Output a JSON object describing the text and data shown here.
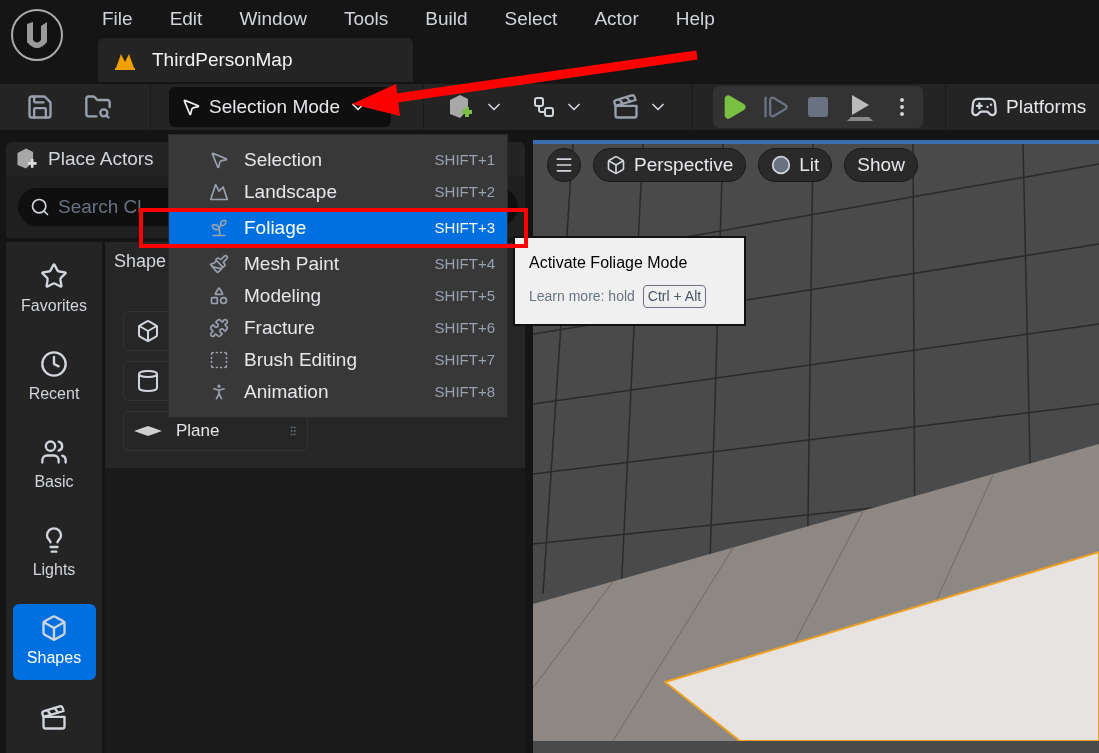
{
  "menu_bar": [
    "File",
    "Edit",
    "Window",
    "Tools",
    "Build",
    "Select",
    "Actor",
    "Help"
  ],
  "document_tab": {
    "title": "ThirdPersonMap",
    "selected": true
  },
  "toolbar": {
    "mode_button": "Selection Mode",
    "platforms_button": "Platforms"
  },
  "place_actors": {
    "title": "Place Actors",
    "search": {
      "placeholder": "Search Cl"
    },
    "categories": [
      {
        "label": "Favorites",
        "selected": false
      },
      {
        "label": "Recent",
        "selected": false
      },
      {
        "label": "Basic",
        "selected": false
      },
      {
        "label": "Lights",
        "selected": false
      },
      {
        "label": "Shapes",
        "selected": true
      },
      {
        "selected": false
      }
    ],
    "section_title": "Shape",
    "items": [
      {
        "kind": "cube"
      },
      {
        "kind": "cylinder"
      },
      {
        "kind": "plane",
        "label": "Plane"
      }
    ]
  },
  "viewport_toolbar": [
    "Perspective",
    "Lit",
    "Show"
  ],
  "mode_menu": [
    {
      "label": "Selection",
      "shortcut": "SHIFT+1",
      "selected": false
    },
    {
      "label": "Landscape",
      "shortcut": "SHIFT+2",
      "selected": false
    },
    {
      "label": "Foliage",
      "shortcut": "SHIFT+3",
      "selected": true
    },
    {
      "label": "Mesh Paint",
      "shortcut": "SHIFT+4",
      "selected": false
    },
    {
      "label": "Modeling",
      "shortcut": "SHIFT+5",
      "selected": false
    },
    {
      "label": "Fracture",
      "shortcut": "SHIFT+6",
      "selected": false
    },
    {
      "label": "Brush Editing",
      "shortcut": "SHIFT+7",
      "selected": false
    },
    {
      "label": "Animation",
      "shortcut": "SHIFT+8",
      "selected": false
    }
  ],
  "tooltip": {
    "title": "Activate Foliage Mode",
    "hint": "Learn more: hold",
    "key": "Ctrl + Alt"
  }
}
